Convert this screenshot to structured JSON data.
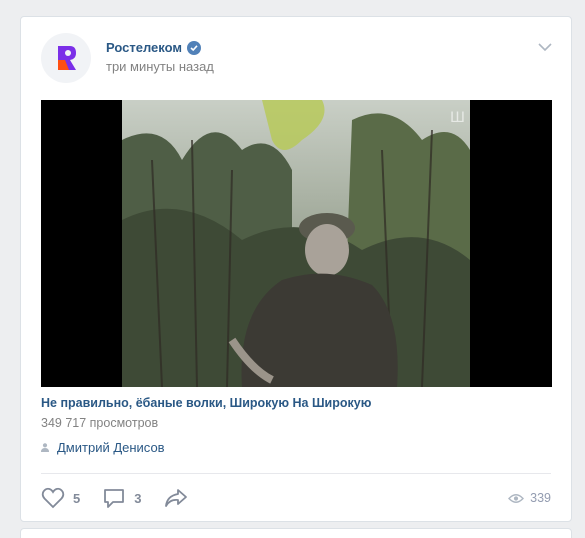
{
  "post": {
    "author_name": "Ростелеком",
    "time": "три минуты назад",
    "video_title": "Не правильно, ёбаные волки, Широкую На Широкую",
    "video_views": "349 717 просмотров",
    "signature": "Дмитрий Денисов",
    "likes": "5",
    "comments": "3",
    "views": "339"
  },
  "icons": {
    "verified": "verified-icon",
    "menu": "chevron-down-icon",
    "person": "person-icon",
    "like": "heart-icon",
    "comment": "comment-icon",
    "share": "share-arrow-icon",
    "views": "eye-icon"
  },
  "colors": {
    "brand_logo": "#7b2fe8",
    "brand_logo_accent": "#ff4f12",
    "link": "#2a5885",
    "muted": "#828282",
    "background": "#edeef0"
  }
}
